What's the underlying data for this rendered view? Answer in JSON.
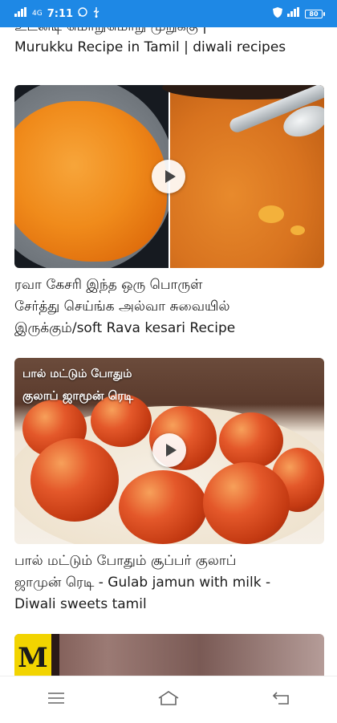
{
  "status_bar": {
    "time": "7:11",
    "network_label": "4G",
    "battery_level": "80",
    "left_icons": [
      "signal-icon",
      "whatsapp-icon",
      "usb-icon"
    ],
    "right_icons": [
      "shield-icon",
      "volte-icon",
      "battery-icon"
    ]
  },
  "feed": {
    "partial_title_line1": "உடனடி மொறுமொறு முறுக்கு |",
    "partial_title_line2": "Murukku Recipe in Tamil | diwali recipes",
    "videos": [
      {
        "title_line1": "ரவா கேசரி இந்த ஒரு பொருள்",
        "title_line2": "சேர்த்து செய்ங்க அல்வா சுவையில்",
        "title_line3": "இருக்கும்/soft Rava kesari Recipe",
        "thumbnail_icon": "kesari-thumbnail",
        "overlay_line1": "",
        "overlay_line2": ""
      },
      {
        "title_line1": "பால் மட்டும் போதும் சூப்பர் குலாப்",
        "title_line2": "ஜாமுன் ரெடி - Gulab jamun with milk -",
        "title_line3": "Diwali sweets tamil",
        "thumbnail_icon": "gulab-jamun-thumbnail",
        "overlay_line1": "பால் மட்டும் போதும்",
        "overlay_line2": "குலாப் ஜாமூன் ரெடி"
      },
      {
        "thumbnail_icon": "next-video-thumbnail",
        "logo_text": "M"
      }
    ]
  },
  "nav_bar": {
    "items": [
      "recents-icon",
      "home-icon",
      "back-icon"
    ]
  },
  "colors": {
    "status_bar": "#1e88e5",
    "background": "#ffffff",
    "text": "#1b1b1b"
  }
}
